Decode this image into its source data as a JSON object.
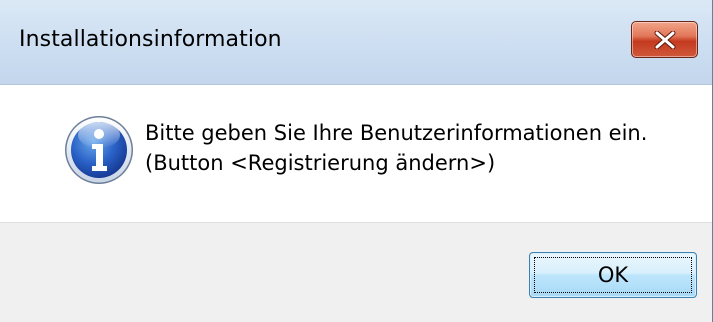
{
  "dialog": {
    "title": "Installationsinformation",
    "message_line1": "Bitte geben Sie Ihre Benutzerinformationen ein.",
    "message_line2": "(Button <Registrierung ändern>)",
    "ok_label": "OK",
    "icon": "information-icon",
    "close_icon": "close-icon"
  }
}
